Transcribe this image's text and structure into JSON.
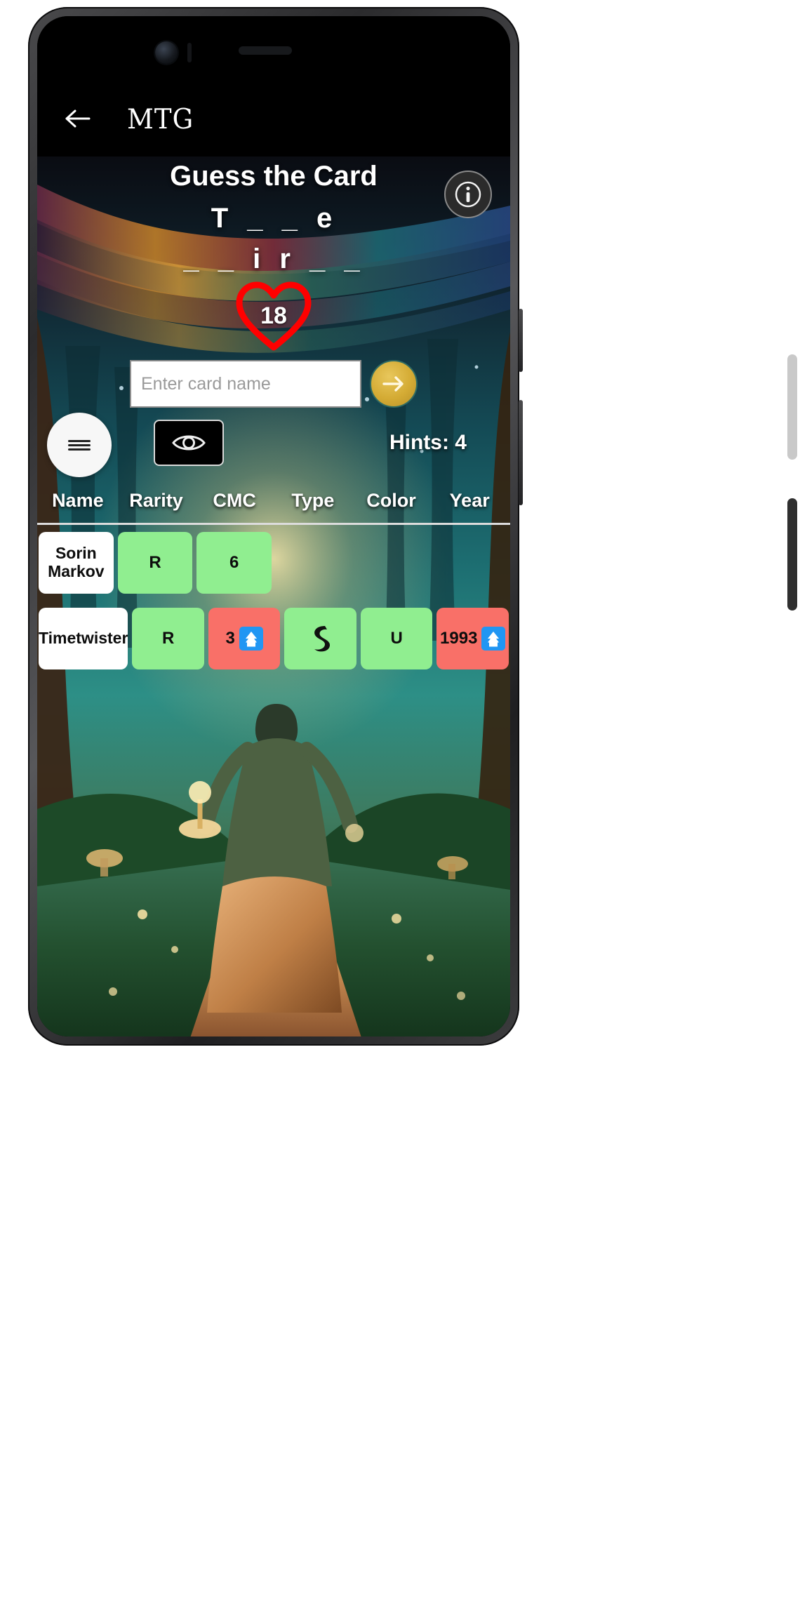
{
  "app": {
    "title": "MTG",
    "back_icon": "back-arrow-icon"
  },
  "game": {
    "title": "Guess the Card",
    "masked_word_line1": "T _ _ e",
    "masked_word_line2": "_ _ i r _ _",
    "lives": "18",
    "hints_label": "Hints: 4",
    "info_icon": "info-icon",
    "reveal_icon": "eye-icon",
    "menu_icon": "hamburger-icon",
    "submit_icon": "arrow-right-icon"
  },
  "input": {
    "placeholder": "Enter card name",
    "value": ""
  },
  "table": {
    "columns": [
      "Name",
      "Rarity",
      "CMC",
      "Type",
      "Color",
      "Year"
    ],
    "rows": [
      {
        "cells": [
          {
            "text": "Sorin Markov",
            "state": "name"
          },
          {
            "text": "R",
            "state": "green"
          },
          {
            "text": "6",
            "state": "green"
          },
          {
            "text": "",
            "state": "empty"
          },
          {
            "text": "",
            "state": "empty"
          },
          {
            "text": "",
            "state": "empty"
          }
        ]
      },
      {
        "cells": [
          {
            "text": "Timetwister",
            "state": "name"
          },
          {
            "text": "R",
            "state": "green"
          },
          {
            "text": "3",
            "state": "red",
            "hint": "up"
          },
          {
            "text": "ʇ",
            "state": "green",
            "glyph": "sorcery-symbol"
          },
          {
            "text": "U",
            "state": "green"
          },
          {
            "text": "1993",
            "state": "red",
            "hint": "up"
          }
        ]
      }
    ]
  },
  "colors": {
    "correct": "#90ee90",
    "incorrect": "#f97068",
    "accent_gold": "#d4ab34",
    "heart": "#ff0000",
    "app_bar": "#000000"
  }
}
